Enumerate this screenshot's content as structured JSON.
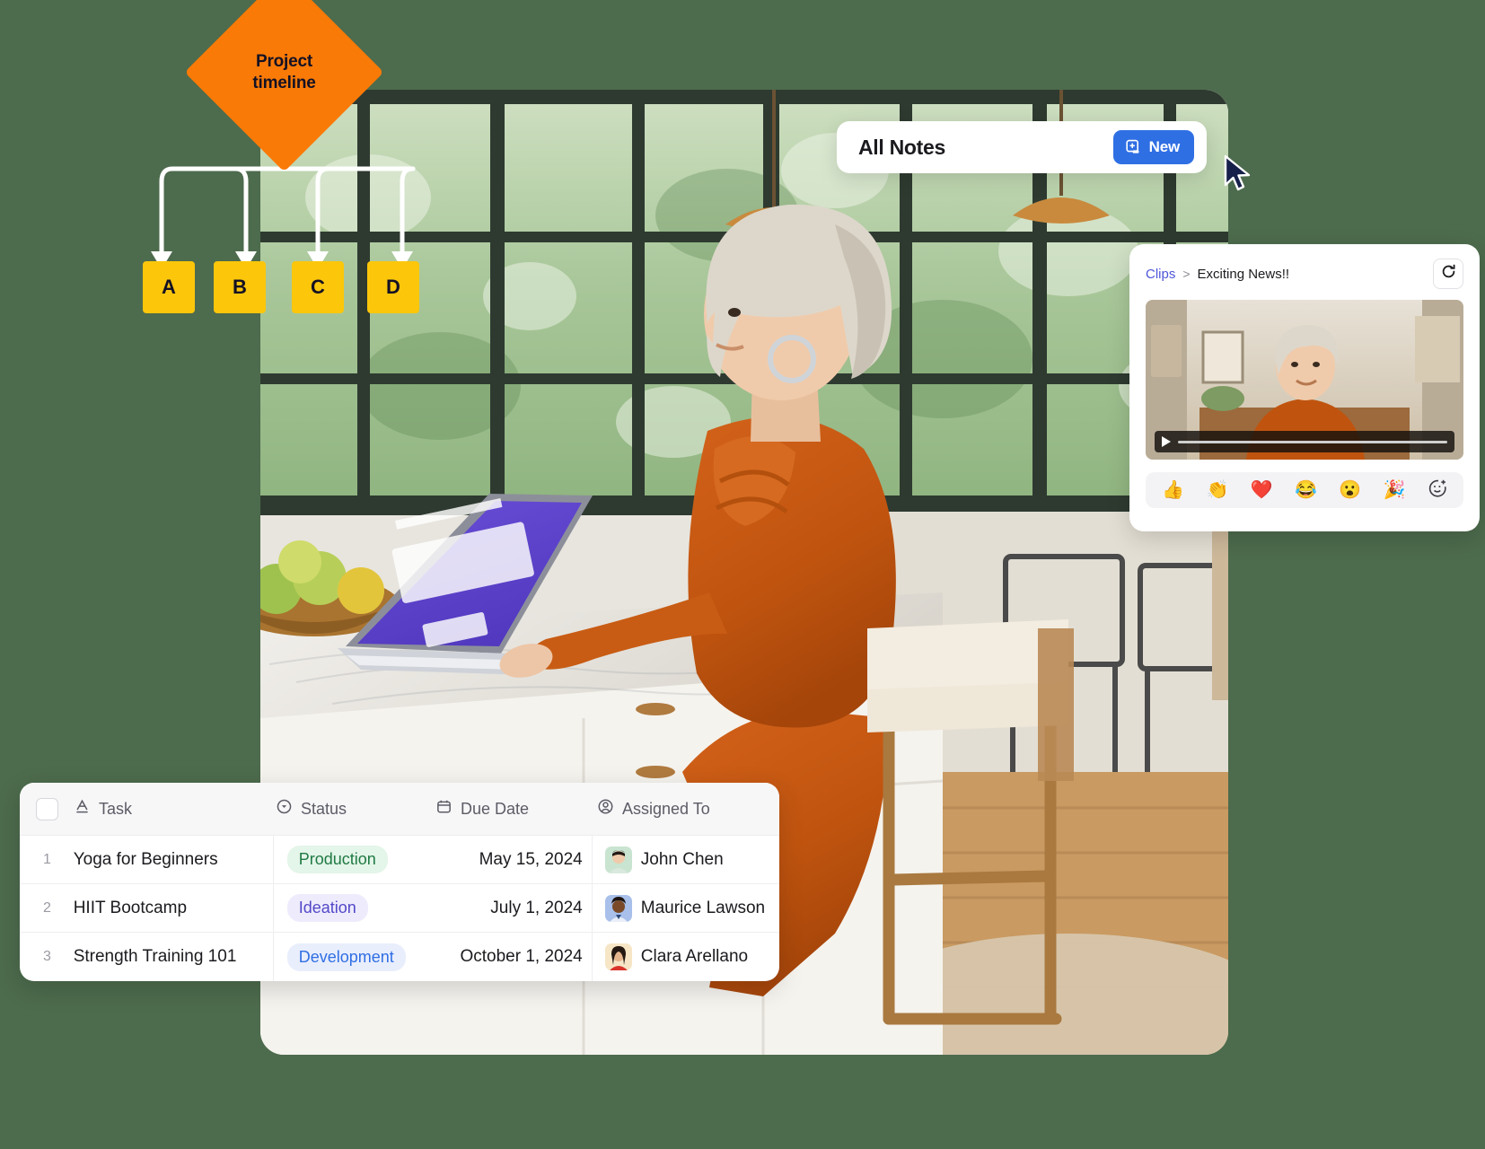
{
  "flowchart": {
    "diamond_label_line1": "Project",
    "diamond_label_line2": "timeline",
    "diamond_color": "#f97a07",
    "node_color": "#fcc60b",
    "nodes": [
      {
        "label": "A"
      },
      {
        "label": "B"
      },
      {
        "label": "C"
      },
      {
        "label": "D"
      }
    ]
  },
  "notes_card": {
    "title": "All Notes",
    "new_button_label": "New",
    "new_button_icon": "new-note-icon",
    "accent_color": "#2f6fe4"
  },
  "clips_panel": {
    "breadcrumb_root": "Clips",
    "breadcrumb_separator": ">",
    "breadcrumb_current": "Exciting News!!",
    "refresh_icon": "refresh-icon",
    "play_icon": "play-icon",
    "link_color": "#4f57d8",
    "reactions": [
      {
        "name": "thumbs-up-reaction",
        "glyph": "👍"
      },
      {
        "name": "clap-reaction",
        "glyph": "👏"
      },
      {
        "name": "heart-reaction",
        "glyph": "❤️"
      },
      {
        "name": "laughing-reaction",
        "glyph": "😂"
      },
      {
        "name": "surprised-reaction",
        "glyph": "😮"
      },
      {
        "name": "party-popper-reaction",
        "glyph": "🎉"
      },
      {
        "name": "add-reaction",
        "glyph": "☺"
      }
    ]
  },
  "task_table": {
    "columns": [
      {
        "label": "Task",
        "icon": "text-field-icon"
      },
      {
        "label": "Status",
        "icon": "single-select-icon"
      },
      {
        "label": "Due Date",
        "icon": "calendar-icon"
      },
      {
        "label": "Assigned To",
        "icon": "person-icon"
      }
    ],
    "rows": [
      {
        "number": "1",
        "task": "Yoga for Beginners",
        "status": "Production",
        "status_style": "green",
        "due_date": "May 15, 2024",
        "assignee": "John Chen"
      },
      {
        "number": "2",
        "task": "HIIT Bootcamp",
        "status": "Ideation",
        "status_style": "purple",
        "due_date": "July 1, 2024",
        "assignee": "Maurice Lawson"
      },
      {
        "number": "3",
        "task": "Strength Training 101",
        "status": "Development",
        "status_style": "blue",
        "due_date": "October 1, 2024",
        "assignee": "Clara Arellano"
      }
    ]
  }
}
